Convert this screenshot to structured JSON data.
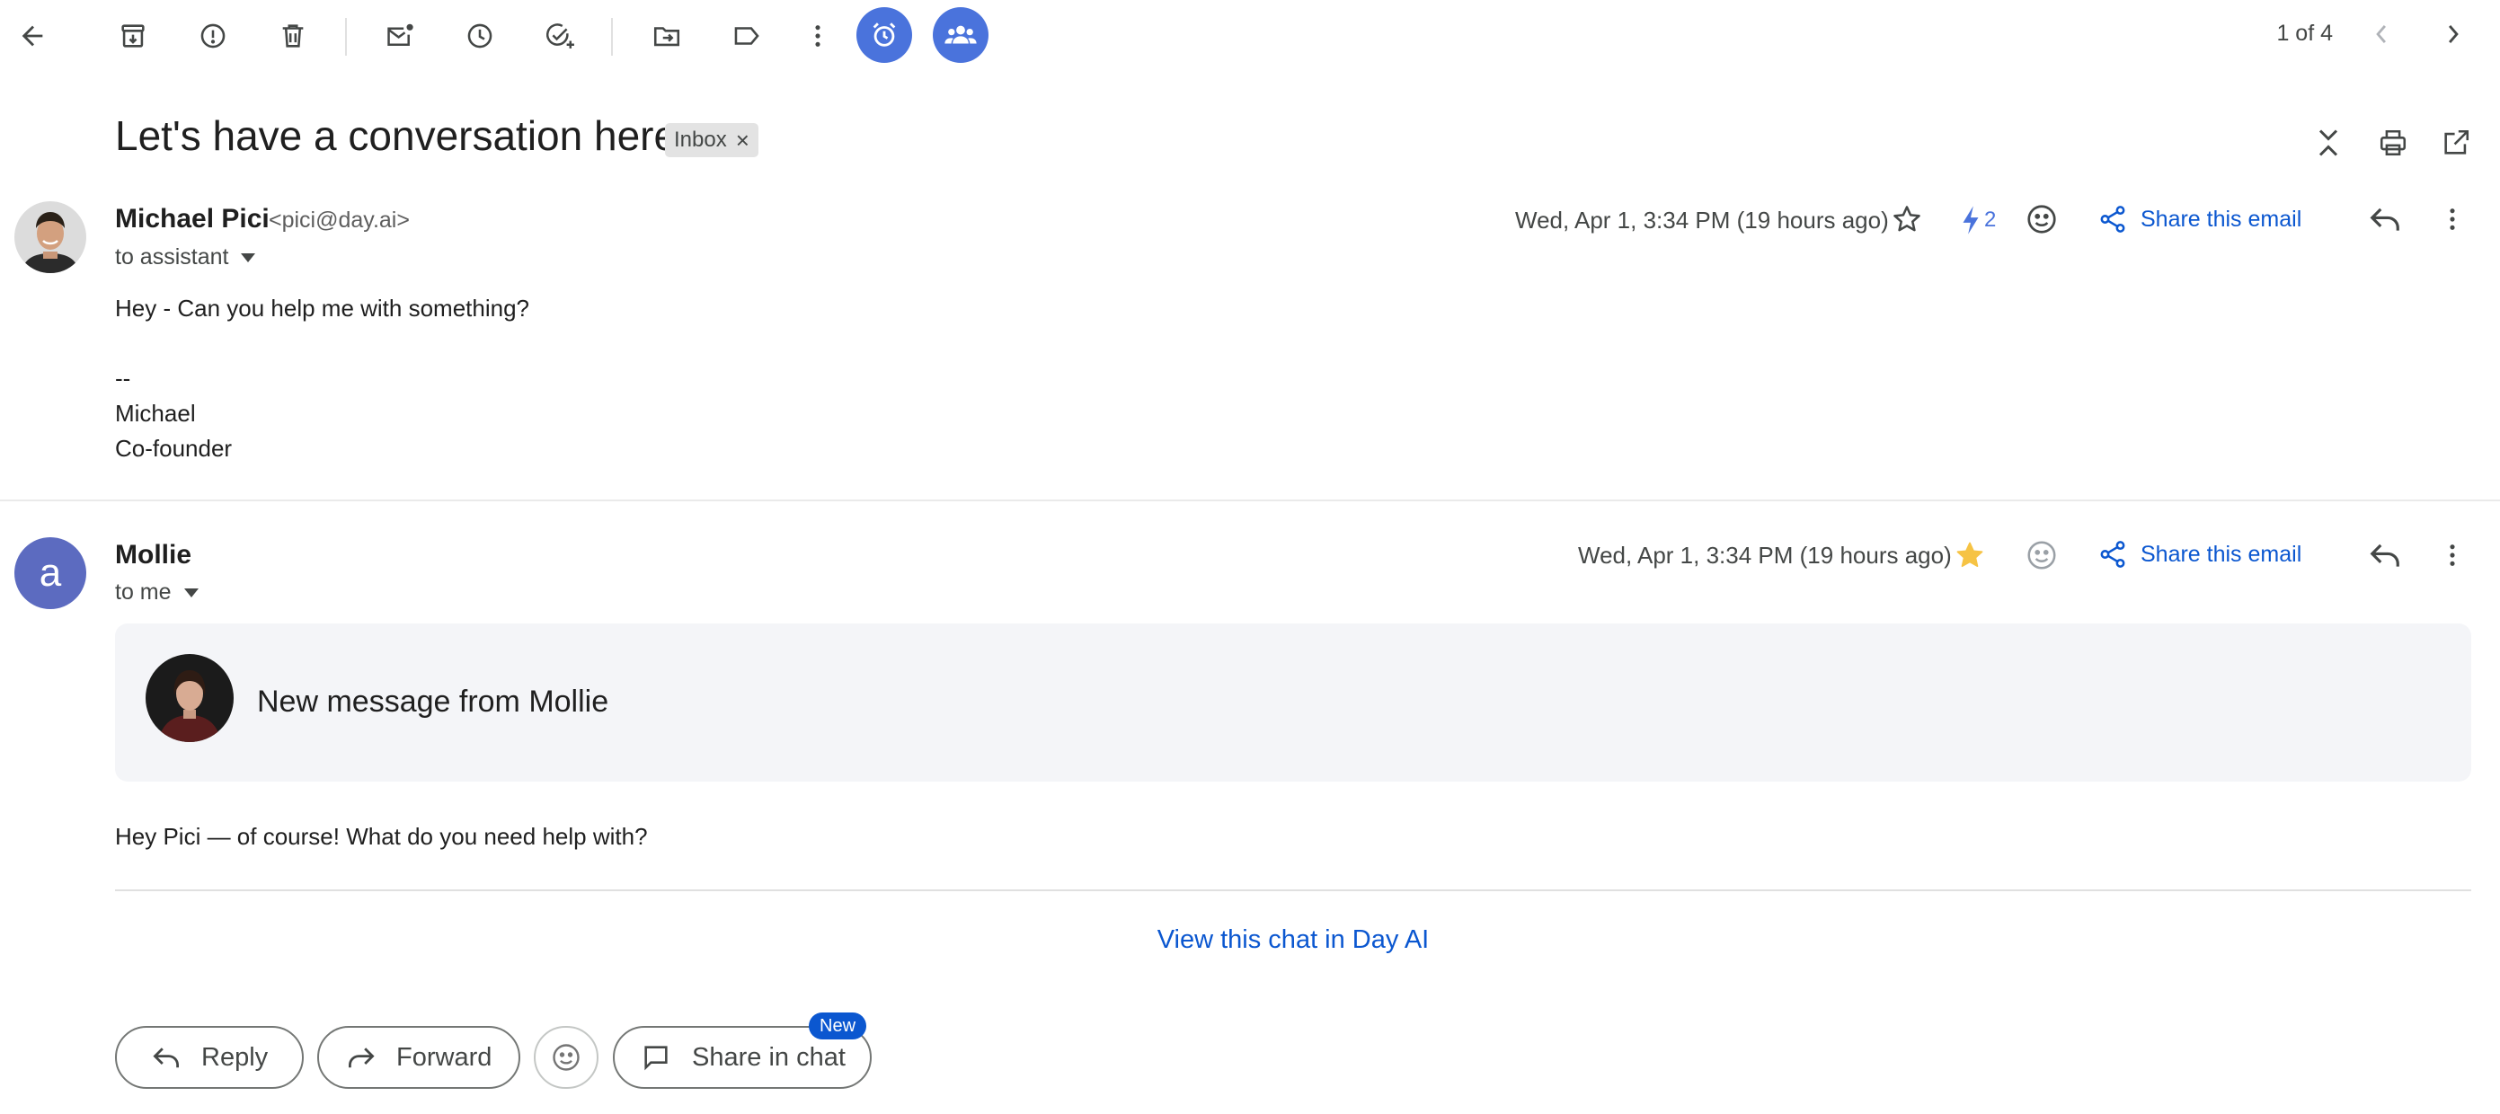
{
  "toolbar": {
    "pager": "1 of 4",
    "icons": [
      "back-arrow-icon",
      "archive-icon",
      "report-spam-icon",
      "delete-icon",
      "mark-unread-icon",
      "snooze-icon",
      "add-task-icon",
      "move-to-icon",
      "label-icon",
      "more-vert-icon",
      "alarm-icon",
      "group-icon",
      "prev-icon",
      "next-icon"
    ]
  },
  "thread": {
    "subject": "Let's have a conversation here",
    "label": "Inbox",
    "label_remove": "×"
  },
  "messages": [
    {
      "sender_name": "Michael Pici",
      "sender_email": "<pici@day.ai>",
      "recipient": "to assistant",
      "date": "Wed, Apr 1, 3:34 PM (19 hours ago)",
      "bolt_count": "2",
      "share": "Share this email",
      "body": [
        "Hey - Can you help me with something?",
        "",
        "--",
        "Michael",
        "Co-founder"
      ]
    },
    {
      "sender_name": "Mollie",
      "avatar_letter": "a",
      "recipient": "to me",
      "date": "Wed, Apr 1, 3:34 PM (19 hours ago)",
      "share": "Share this email",
      "card_text": "New message from Mollie",
      "body": "Hey Pici — of course! What do you need help with?",
      "view_link": "View this chat in Day AI"
    }
  ],
  "actions": {
    "reply": "Reply",
    "forward": "Forward",
    "share_chat": "Share in chat",
    "new_badge": "New"
  },
  "colors": {
    "accent": "#4a73dc",
    "link": "#0b57d0",
    "star": "#f6c344",
    "avatar": "#5c6bc0"
  }
}
